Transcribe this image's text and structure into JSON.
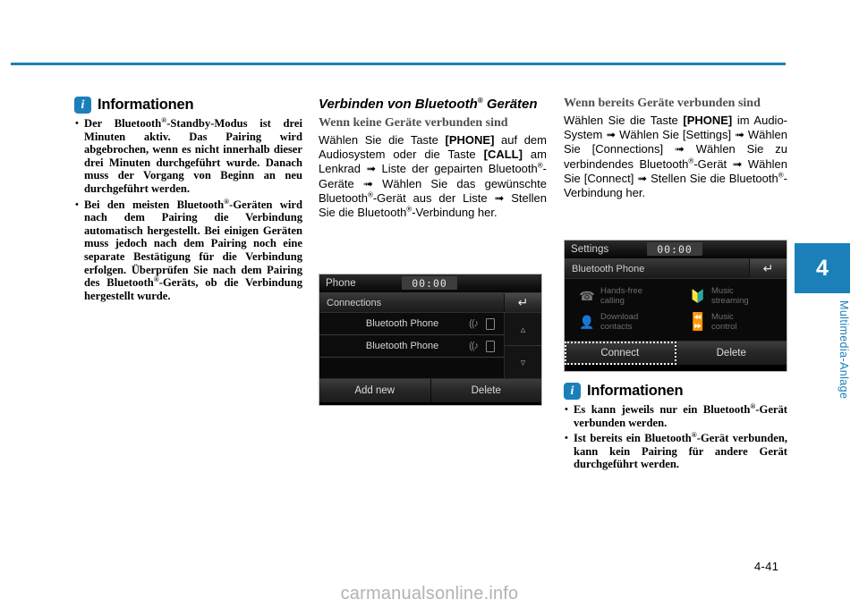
{
  "page": {
    "number": "4-41",
    "watermark": "carmanualsonline.info",
    "chapter_number": "4",
    "chapter_label": "Multimedia-Anlage",
    "accent_color": "#1b7fba"
  },
  "column_left": {
    "info_box": {
      "icon": "info-icon",
      "icon_letter": "i",
      "title": "Informationen",
      "items": [
        "Der Bluetooth®-Standby-Modus ist drei Minuten aktiv. Das Pairing wird abgebrochen, wenn es nicht innerhalb dieser drei Minuten durchgeführt wurde. Danach muss der Vorgang von Beginn an neu durchgeführt werden.",
        "Bei den meisten Bluetooth®-Geräten wird nach dem Pairing die Verbindung automatisch hergestellt. Bei einigen Geräten muss jedoch nach dem Pairing noch eine separate Bestätigung für die Verbindung erfolgen. Überprüfen Sie nach dem Pairing des Bluetooth®-Geräts, ob die Verbindung hergestellt wurde."
      ]
    }
  },
  "column_middle": {
    "section_title": "Verbinden von Bluetooth® Geräten",
    "sub_title": "Wenn keine Geräte verbunden sind",
    "body_text": "Wählen Sie die Taste [PHONE] auf dem Audiosystem oder die Taste [CALL] am Lenkrad ➟ Liste der gepairten Bluetooth®-Geräte ➟ Wählen Sie das gewünschte Bluetooth®-Gerät aus der Liste ➟ Stellen Sie die Bluetooth®-Verbindung her.",
    "screenshot": {
      "title": "Phone",
      "clock": "00:00",
      "subtitle": "Connections",
      "back_icon": "back-arrow-icon",
      "rows": [
        {
          "name": "Bluetooth Phone",
          "icons": [
            "bt-audio-icon",
            "phone-icon"
          ]
        },
        {
          "name": "Bluetooth Phone",
          "icons": [
            "bt-audio-icon",
            "phone-icon"
          ]
        }
      ],
      "scroll_up_icon": "chevron-up-icon",
      "scroll_down_icon": "chevron-down-icon",
      "buttons": [
        {
          "label": "Add new",
          "selected": false
        },
        {
          "label": "Delete",
          "selected": false
        }
      ]
    }
  },
  "column_right": {
    "sub_title": "Wenn bereits Geräte verbunden sind",
    "body_text": "Wählen Sie die Taste [PHONE] im Audio-System ➟ Wählen Sie [Settings] ➟ Wählen Sie [Connections] ➟ Wählen Sie zu verbindendes Bluetooth®-Gerät ➟ Wählen Sie [Connect] ➟ Stellen Sie die Bluetooth®-Verbindung her.",
    "screenshot": {
      "title": "Settings",
      "clock": "00:00",
      "subtitle": "Bluetooth Phone",
      "back_icon": "back-arrow-icon",
      "features": [
        {
          "icon": "handsfree-calling-icon",
          "line1": "Hands-free",
          "line2": "calling"
        },
        {
          "icon": "music-streaming-icon",
          "line1": "Music",
          "line2": "streaming"
        },
        {
          "icon": "download-contacts-icon",
          "line1": "Download",
          "line2": "contacts"
        },
        {
          "icon": "music-control-icon",
          "line1": "Music",
          "line2": "control"
        }
      ],
      "buttons": [
        {
          "label": "Connect",
          "selected": true
        },
        {
          "label": "Delete",
          "selected": false
        }
      ]
    },
    "info_box": {
      "icon": "info-icon",
      "icon_letter": "i",
      "title": "Informationen",
      "items": [
        "Es kann jeweils nur ein Bluetooth®-Gerät verbunden werden.",
        "Ist bereits ein Bluetooth®-Gerät verbunden, kann kein Pairing für andere Gerät durchgeführt werden."
      ]
    }
  }
}
